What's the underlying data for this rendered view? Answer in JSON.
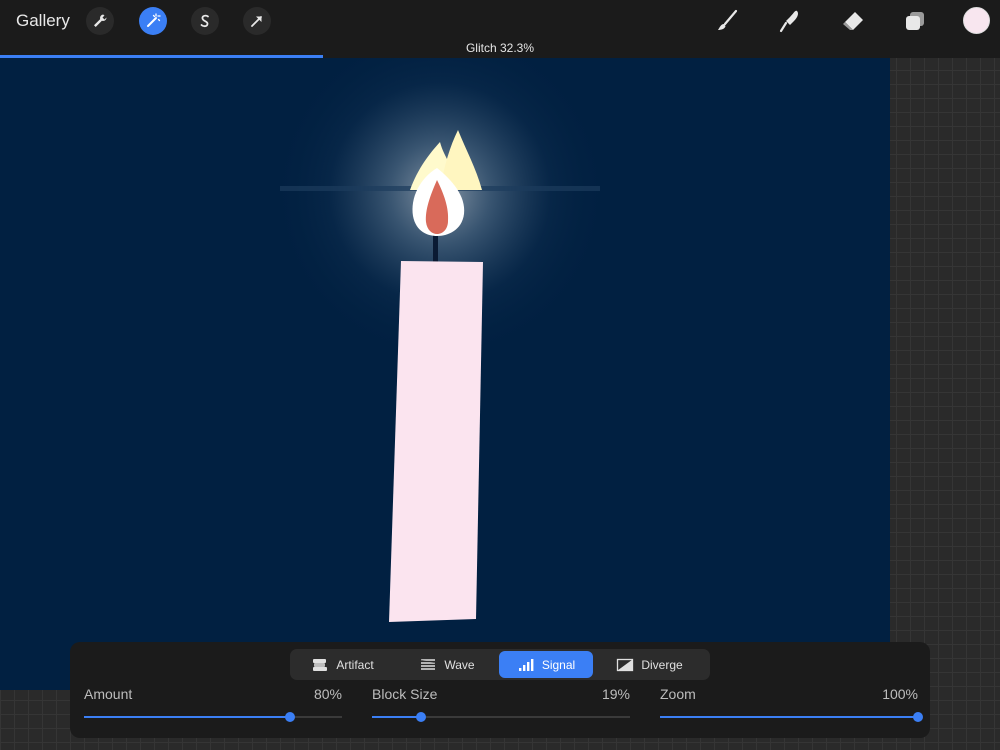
{
  "toolbar": {
    "gallery_label": "Gallery",
    "left_tools": [
      {
        "name": "wrench-icon",
        "active": false
      },
      {
        "name": "magic-wand-icon",
        "active": true
      },
      {
        "name": "selection-s-icon",
        "active": false
      },
      {
        "name": "arrow-cursor-icon",
        "active": false
      }
    ],
    "right_tools": [
      "brush-icon",
      "smudge-icon",
      "eraser-icon",
      "layers-icon"
    ],
    "current_color": "#f8e6ef",
    "accent_color": "#3b7ff5"
  },
  "progress": {
    "label": "Glitch 32.3%",
    "value": 0.323
  },
  "canvas": {
    "background_color": "#012041"
  },
  "panel": {
    "tabs": [
      {
        "label": "Artifact",
        "icon": "artifact-icon",
        "active": false
      },
      {
        "label": "Wave",
        "icon": "wave-icon",
        "active": false
      },
      {
        "label": "Signal",
        "icon": "signal-icon",
        "active": true
      },
      {
        "label": "Diverge",
        "icon": "diverge-icon",
        "active": false
      }
    ],
    "sliders": [
      {
        "name": "Amount",
        "value_text": "80%",
        "value": 0.8
      },
      {
        "name": "Block Size",
        "value_text": "19%",
        "value": 0.19
      },
      {
        "name": "Zoom",
        "value_text": "100%",
        "value": 1.0
      }
    ]
  }
}
